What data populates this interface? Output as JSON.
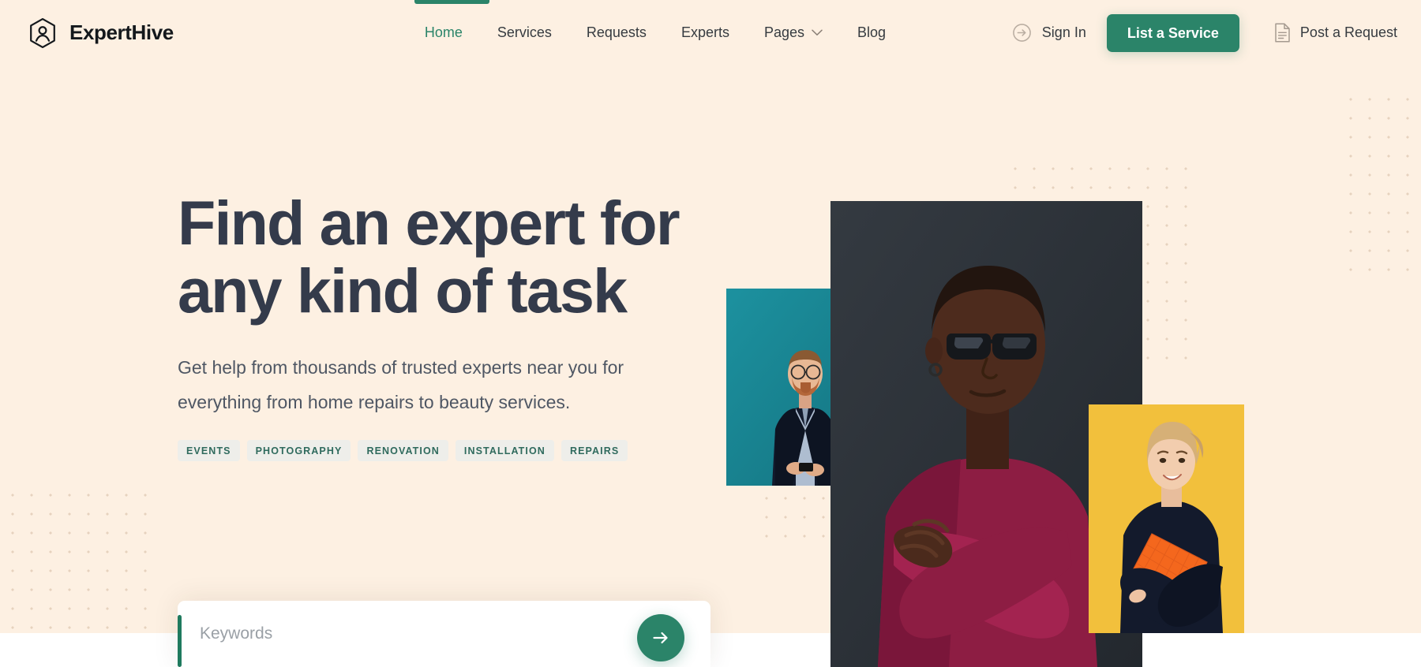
{
  "brand": {
    "name": "ExpertHive",
    "logo_icon": "hexagon-person-icon"
  },
  "colors": {
    "background": "#fdf0e2",
    "accent_green": "#2b8469",
    "headline": "#343b4b",
    "body_text": "#4f5764",
    "tag_text": "#2f6a5d",
    "tag_bg": "#eeeeea"
  },
  "header": {
    "nav": [
      {
        "label": "Home",
        "active": true,
        "has_dropdown": false
      },
      {
        "label": "Services",
        "active": false,
        "has_dropdown": false
      },
      {
        "label": "Requests",
        "active": false,
        "has_dropdown": false
      },
      {
        "label": "Experts",
        "active": false,
        "has_dropdown": false
      },
      {
        "label": "Pages",
        "active": false,
        "has_dropdown": true
      },
      {
        "label": "Blog",
        "active": false,
        "has_dropdown": false
      }
    ],
    "sign_in": {
      "label": "Sign In",
      "icon": "arrow-right-circle-icon"
    },
    "cta_button": {
      "label": "List a Service"
    },
    "post_request": {
      "label": "Post a Request",
      "icon": "document-icon"
    }
  },
  "hero": {
    "headline_line1": "Find an expert for",
    "headline_line2": "any kind of task",
    "subtitle_line1": "Get help from thousands of trusted experts near you for",
    "subtitle_line2": "everything from home repairs to beauty services.",
    "tags": [
      "EVENTS",
      "PHOTOGRAPHY",
      "RENOVATION",
      "INSTALLATION",
      "REPAIRS"
    ],
    "images": [
      {
        "name": "expert-photo-man-suit-teal",
        "background": "#1b8a9b"
      },
      {
        "name": "expert-photo-man-maroon-dark",
        "background": "#2e343a"
      },
      {
        "name": "expert-photo-woman-orange-folder",
        "background": "#f0c23f"
      }
    ]
  },
  "search": {
    "placeholder": "Keywords",
    "value": "",
    "submit_icon": "arrow-right-icon"
  }
}
